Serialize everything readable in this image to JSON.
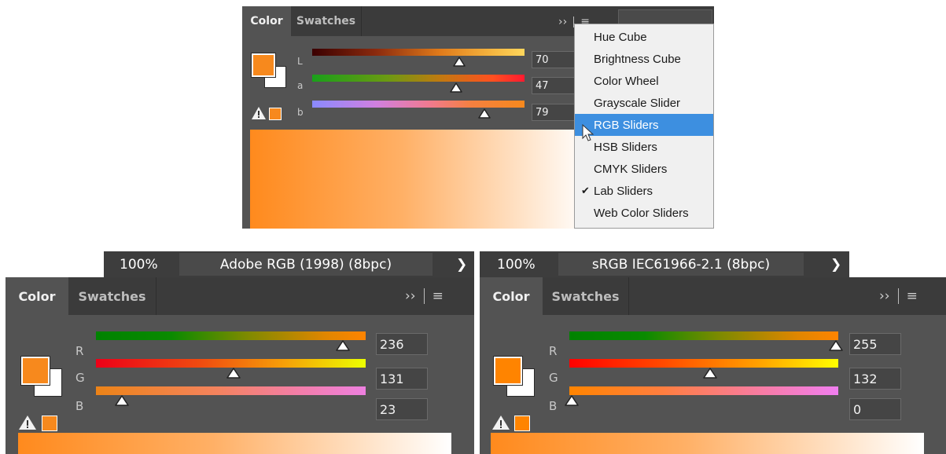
{
  "top_panel": {
    "tabs": [
      "Color",
      "Swatches"
    ],
    "more_icon": "double-chevron-right-icon",
    "menu_icon": "hamburger-menu-icon",
    "channels": [
      {
        "label": "L",
        "value": "70",
        "thumb_fraction": 0.7
      },
      {
        "label": "a",
        "value": "47",
        "thumb_fraction": 0.68
      },
      {
        "label": "b",
        "value": "79",
        "thumb_fraction": 0.8
      }
    ],
    "foreground_color": "#f7891d",
    "background_color": "#ffffff"
  },
  "flyout_menu": {
    "items": [
      {
        "label": "Hue Cube",
        "checked": false,
        "highlighted": false
      },
      {
        "label": "Brightness Cube",
        "checked": false,
        "highlighted": false
      },
      {
        "label": "Color Wheel",
        "checked": false,
        "highlighted": false
      },
      {
        "label": "Grayscale Slider",
        "checked": false,
        "highlighted": false
      },
      {
        "label": "RGB Sliders",
        "checked": false,
        "highlighted": true
      },
      {
        "label": "HSB Sliders",
        "checked": false,
        "highlighted": false
      },
      {
        "label": "CMYK Sliders",
        "checked": false,
        "highlighted": false
      },
      {
        "label": "Lab Sliders",
        "checked": true,
        "highlighted": false
      },
      {
        "label": "Web Color Sliders",
        "checked": false,
        "highlighted": false
      }
    ],
    "check_glyph": "✔"
  },
  "left_panel": {
    "status": {
      "zoom": "100%",
      "profile": "Adobe RGB (1998) (8bpc)",
      "chevron": "❯"
    },
    "tabs": [
      "Color",
      "Swatches"
    ],
    "channels": [
      {
        "label": "R",
        "value": "236",
        "thumb_fraction": 0.925
      },
      {
        "label": "G",
        "value": "131",
        "thumb_fraction": 0.51
      },
      {
        "label": "B",
        "value": "23",
        "thumb_fraction": 0.09
      }
    ],
    "foreground_color": "#f7891d"
  },
  "right_panel": {
    "status": {
      "zoom": "100%",
      "profile": "sRGB IEC61966-2.1 (8bpc)",
      "chevron": "❯"
    },
    "tabs": [
      "Color",
      "Swatches"
    ],
    "channels": [
      {
        "label": "R",
        "value": "255",
        "thumb_fraction": 1.0
      },
      {
        "label": "G",
        "value": "132",
        "thumb_fraction": 0.52
      },
      {
        "label": "B",
        "value": "0",
        "thumb_fraction": 0.0
      }
    ],
    "foreground_color": "#ff8400"
  },
  "toolbar_glyphs": {
    "more": "››",
    "separator": "|",
    "menu": "≡"
  }
}
